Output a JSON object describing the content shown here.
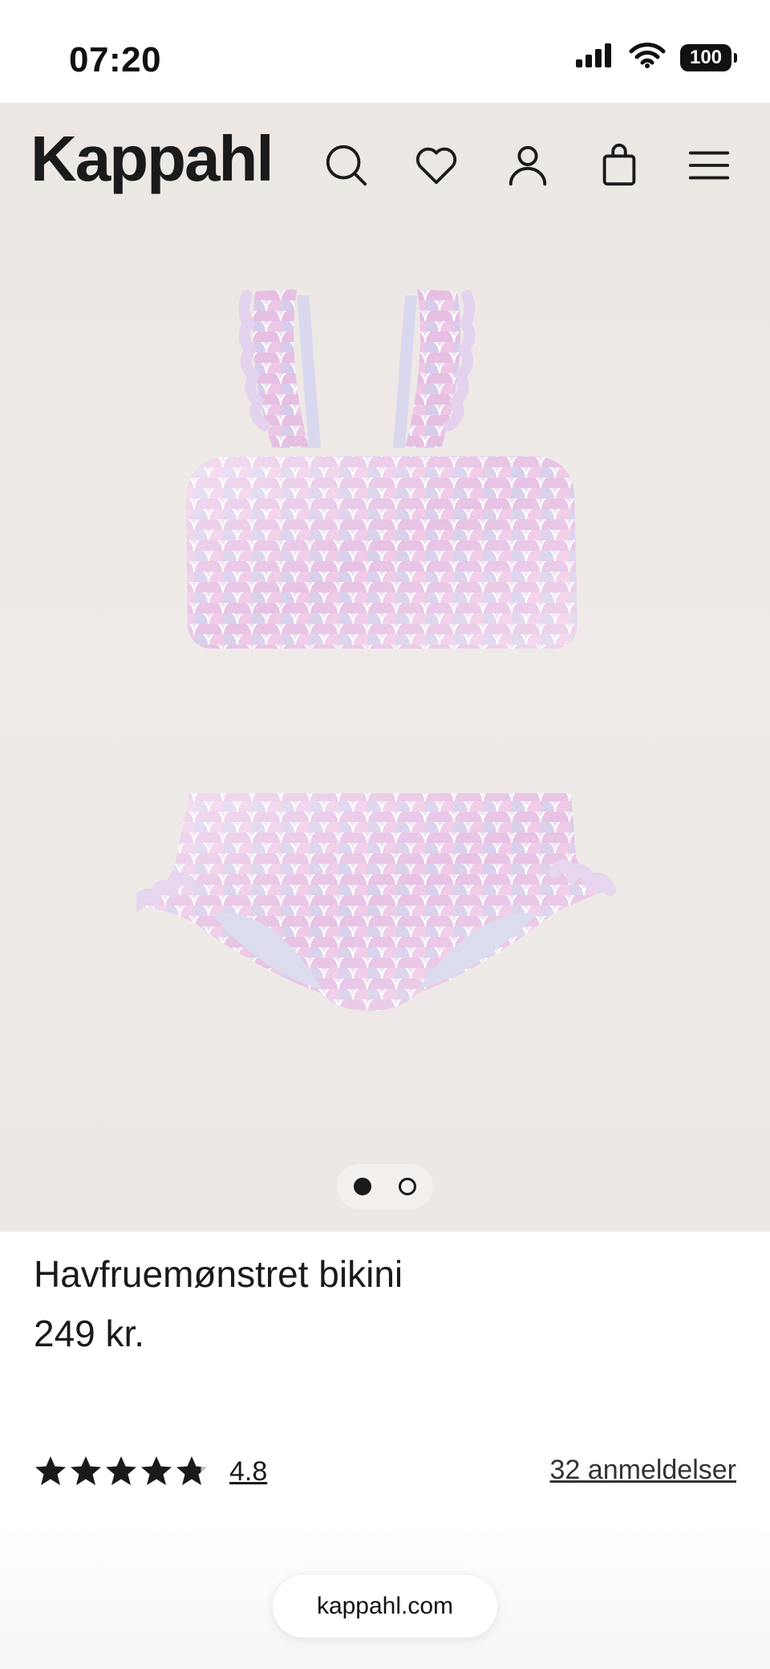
{
  "status_bar": {
    "time": "07:20",
    "battery": "100",
    "icons": [
      "cellular-signal-icon",
      "wifi-icon",
      "battery-icon"
    ]
  },
  "header": {
    "logo": "Kappahl",
    "icons": [
      "search-icon",
      "heart-icon",
      "account-icon",
      "bag-icon",
      "menu-icon"
    ]
  },
  "product": {
    "image_alt_icon": "mermaid-bikini-image",
    "carousel": {
      "count": 2,
      "active_index": 0
    },
    "title": "Havfruemønstret bikini",
    "price": "249 kr."
  },
  "rating": {
    "value": "4.8",
    "stars": 4.8,
    "max_stars": 5,
    "reviews_label": "32 anmeldelser"
  },
  "browser": {
    "url": "kappahl.com"
  },
  "colors": {
    "hero_background": "#ece7e3",
    "text": "#1a1a1a",
    "swimsuit_pink": "#e6bfe3",
    "swimsuit_lilac": "#dcd4ee"
  }
}
